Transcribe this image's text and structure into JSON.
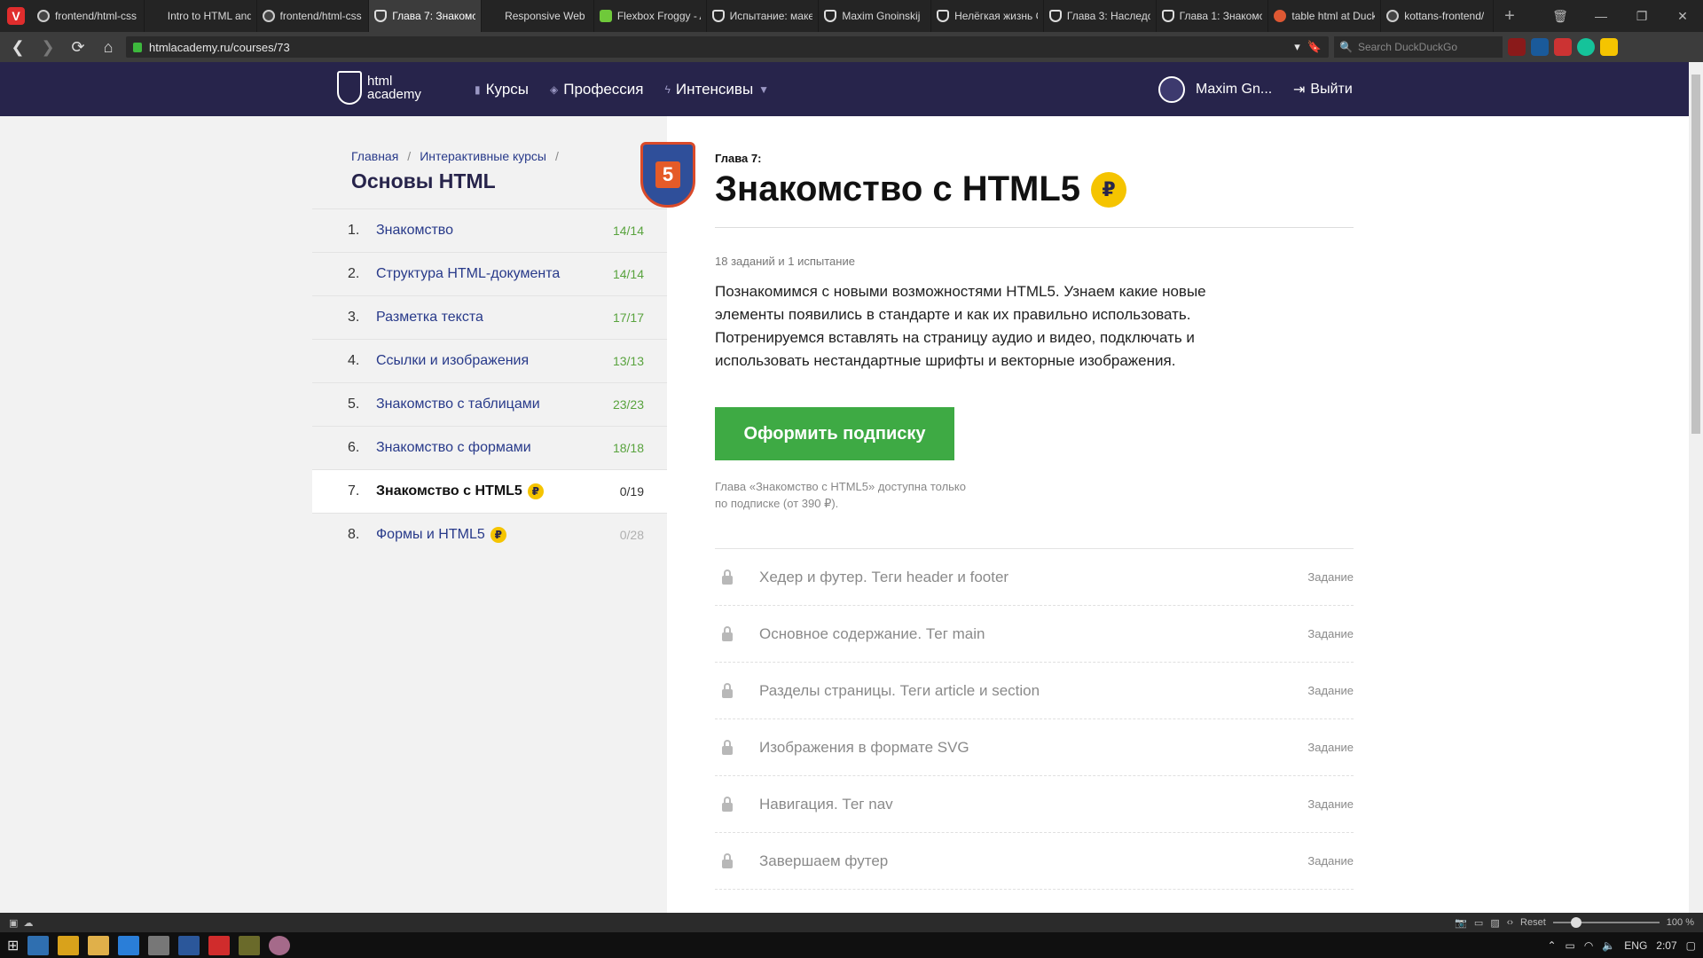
{
  "browser": {
    "tabs": [
      {
        "label": "frontend/html-css",
        "icon": "github-icon",
        "active": false
      },
      {
        "label": "Intro to HTML and",
        "icon": "w-icon",
        "active": false
      },
      {
        "label": "frontend/html-css",
        "icon": "github-icon",
        "active": false
      },
      {
        "label": "Глава 7: Знакомс",
        "icon": "shield-icon",
        "active": true
      },
      {
        "label": "Responsive Web D",
        "icon": "w-icon",
        "active": false
      },
      {
        "label": "Flexbox Froggy - A",
        "icon": "frog-icon",
        "active": false
      },
      {
        "label": "Испытание: маке",
        "icon": "shield-icon",
        "active": false
      },
      {
        "label": "Maxim Gnoinskij",
        "icon": "shield-icon",
        "active": false
      },
      {
        "label": "Нелёгкая жизнь С",
        "icon": "shield-icon",
        "active": false
      },
      {
        "label": "Глава 3: Наследо",
        "icon": "shield-icon",
        "active": false
      },
      {
        "label": "Глава 1: Знакомс",
        "icon": "shield-icon",
        "active": false
      },
      {
        "label": "table html at Duck",
        "icon": "duck-icon",
        "active": false
      },
      {
        "label": "kottans-frontend/",
        "icon": "github-icon",
        "active": false
      }
    ],
    "url": "htmlacademy.ru/courses/73",
    "search_placeholder": "Search DuckDuckGo"
  },
  "site": {
    "logo_line1": "html",
    "logo_line2": "academy",
    "nav": [
      {
        "label": "Курсы",
        "icon": "bars-icon"
      },
      {
        "label": "Профессия",
        "icon": "diamond-icon"
      },
      {
        "label": "Интенсивы",
        "icon": "bolt-icon",
        "dropdown": true
      }
    ],
    "user_name": "Maxim Gn...",
    "logout_label": "Выйти"
  },
  "sidebar": {
    "breadcrumb": [
      "Главная",
      "Интерактивные курсы"
    ],
    "course_title": "Основы HTML",
    "badge_text": "5",
    "chapters": [
      {
        "num": "1.",
        "title": "Знакомство",
        "progress": "14/14",
        "state": "done"
      },
      {
        "num": "2.",
        "title": "Структура HTML-документа",
        "progress": "14/14",
        "state": "done"
      },
      {
        "num": "3.",
        "title": "Разметка текста",
        "progress": "17/17",
        "state": "done"
      },
      {
        "num": "4.",
        "title": "Ссылки и изображения",
        "progress": "13/13",
        "state": "done"
      },
      {
        "num": "5.",
        "title": "Знакомство с таблицами",
        "progress": "23/23",
        "state": "done"
      },
      {
        "num": "6.",
        "title": "Знакомство с формами",
        "progress": "18/18",
        "state": "done"
      },
      {
        "num": "7.",
        "title": "Знакомство с HTML5",
        "progress": "0/19",
        "state": "active",
        "paid": true
      },
      {
        "num": "8.",
        "title": "Формы и HTML5",
        "progress": "0/28",
        "state": "locked",
        "paid": true
      }
    ]
  },
  "main": {
    "chapter_label": "Глава 7:",
    "chapter_title": "Знакомство с HTML5",
    "coin_symbol": "₽",
    "meta": "18 заданий и 1 испытание",
    "description": "Познакомимся с новыми возможностями HTML5. Узнаем какие новые элементы появились в стандарте и как их правильно использовать. Потренируемся вставлять на страницу аудио и видео, подключать и использовать нестандартные шрифты и векторные изображения.",
    "subscribe_label": "Оформить подписку",
    "note": "Глава «Знакомство с HTML5» доступна только по подписке (от 390 ₽).",
    "tasks": [
      {
        "title": "Хедер и футер. Теги header и footer",
        "type": "Задание"
      },
      {
        "title": "Основное содержание. Тег main",
        "type": "Задание"
      },
      {
        "title": "Разделы страницы. Теги article и section",
        "type": "Задание"
      },
      {
        "title": "Изображения в формате SVG",
        "type": "Задание"
      },
      {
        "title": "Навигация. Тег nav",
        "type": "Задание"
      },
      {
        "title": "Завершаем футер",
        "type": "Задание"
      }
    ]
  },
  "statusbar": {
    "reset_label": "Reset",
    "zoom": "100 %"
  },
  "taskbar": {
    "lang": "ENG",
    "time": "2:07"
  }
}
